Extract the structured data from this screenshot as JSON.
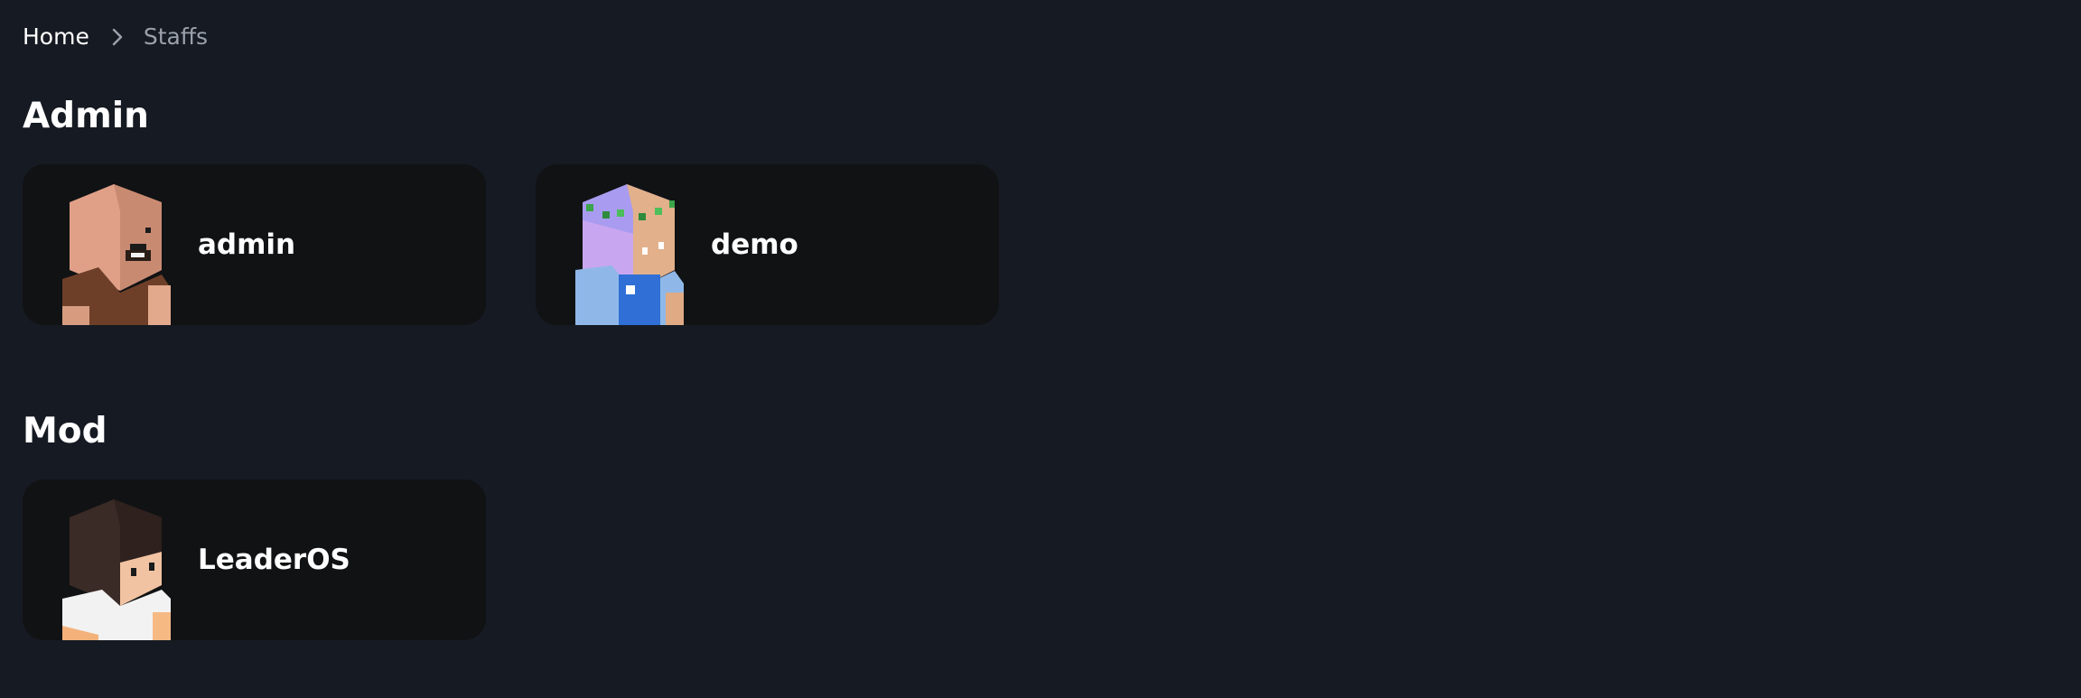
{
  "breadcrumb": {
    "home": "Home",
    "current": "Staffs"
  },
  "sections": [
    {
      "title": "Admin",
      "members": [
        {
          "name": "admin"
        },
        {
          "name": "demo"
        }
      ]
    },
    {
      "title": "Mod",
      "members": [
        {
          "name": "LeaderOS"
        }
      ]
    }
  ],
  "colors": {
    "background": "#161a22",
    "card": "#111214",
    "muted": "#9aa1ad"
  }
}
